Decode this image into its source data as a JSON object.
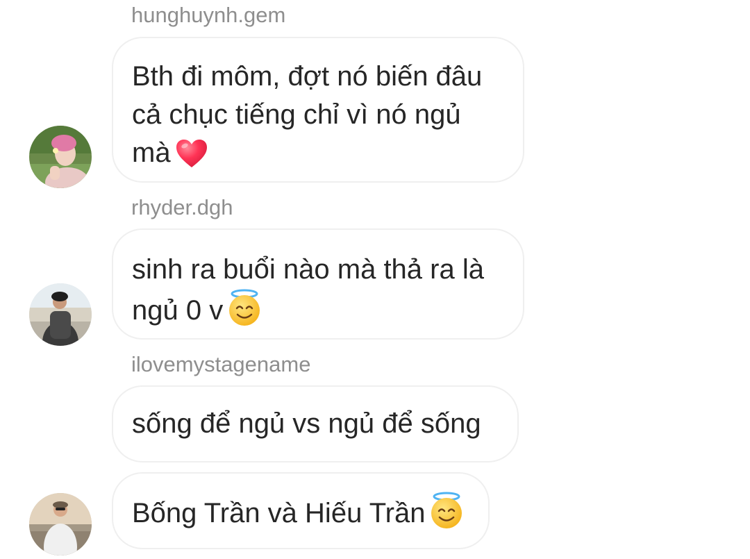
{
  "messages": [
    {
      "sender": "hunghuynh.gem",
      "text": "Bth đi môm, đợt nó biến đâu cả chục tiếng chỉ vì nó ngủ mà",
      "emoji": "red-heart"
    },
    {
      "sender": "rhyder.dgh",
      "text": "sinh ra buổi nào mà thả ra là ngủ 0 v",
      "emoji": "smiling-face-with-halo"
    },
    {
      "sender": "ilovemystagename",
      "text": "sống để ngủ vs ngủ để sống",
      "emoji": ""
    },
    {
      "sender": "",
      "text": "Bống Trần và Hiếu Trần",
      "emoji": "smiling-face-with-halo"
    }
  ],
  "colors": {
    "sender_text": "#8e8e8e",
    "message_text": "#262626",
    "bubble_border": "#efefef",
    "heart": "#ff3355",
    "halo": "#4fb3f2"
  }
}
